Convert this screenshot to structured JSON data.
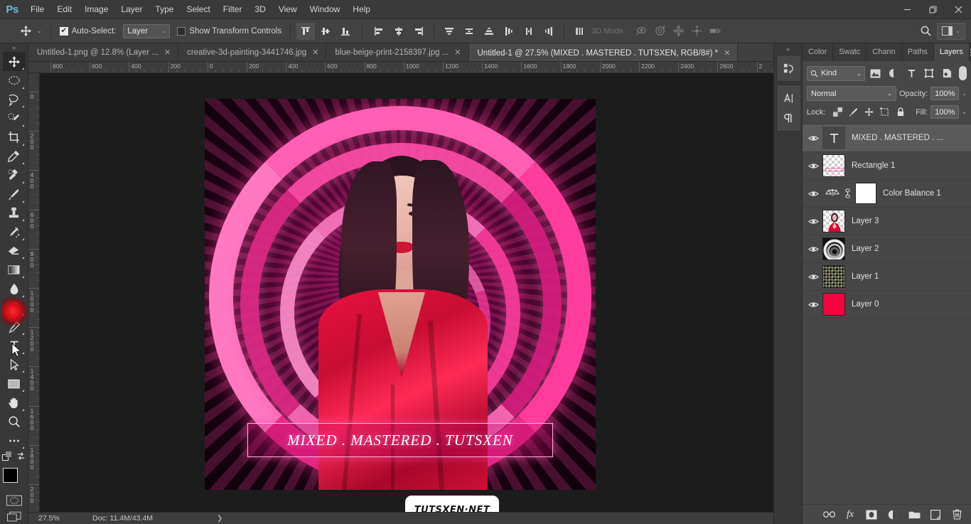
{
  "app": {
    "logo": "Ps",
    "menus": [
      "File",
      "Edit",
      "Image",
      "Layer",
      "Type",
      "Select",
      "Filter",
      "3D",
      "View",
      "Window",
      "Help"
    ],
    "window_controls": {
      "minimize": "—",
      "maximize": "❐",
      "close": "✕"
    }
  },
  "options_bar": {
    "tool_name": "move-tool",
    "auto_select_label": "Auto-Select:",
    "auto_select_checked": true,
    "auto_select_value": "Layer",
    "show_transform_label": "Show Transform Controls",
    "show_transform_checked": false,
    "align_buttons": [
      "align-top-edges",
      "align-vertical-centers",
      "align-bottom-edges",
      "align-left-edges",
      "align-horizontal-centers",
      "align-right-edges",
      "distribute-top-edges",
      "distribute-vertical-centers",
      "distribute-bottom-edges",
      "distribute-left-edges",
      "distribute-horizontal-centers",
      "distribute-right-edges",
      "align-distribute-options"
    ],
    "mode_3d_label": "3D Mode:",
    "mode_3d_icons": [
      "orbit-3d-icon",
      "roll-3d-icon",
      "pan-3d-icon",
      "slide-3d-icon",
      "scale-3d-icon"
    ],
    "search_icon": "search-icon",
    "workspace_icon": "workspace-switcher-icon"
  },
  "tabs": [
    {
      "title": "Untitled-1.png @ 12.8% (Layer ...",
      "active": false,
      "close": "✕"
    },
    {
      "title": "creative-3d-painting-3441746.jpg",
      "active": false,
      "close": "✕"
    },
    {
      "title": "blue-beige-print-2158397.jpg ...",
      "active": false,
      "close": "✕"
    },
    {
      "title": "Untitled-1 @ 27.5% (MIXED .  MASTERED  .  TUTSXEN, RGB/8#) *",
      "active": true,
      "close": "✕"
    }
  ],
  "toolbar": {
    "collapse_icon": "double-chevron-right-icon",
    "tools_top": [
      {
        "name": "move-tool",
        "active": true
      },
      {
        "name": "elliptical-marquee-tool",
        "active": false
      },
      {
        "name": "lasso-tool",
        "active": false
      },
      {
        "name": "quick-selection-tool",
        "active": false
      },
      {
        "name": "crop-tool",
        "active": false
      },
      {
        "name": "eyedropper-tool",
        "active": false
      },
      {
        "name": "spot-healing-brush-tool",
        "active": false
      },
      {
        "name": "brush-tool",
        "active": false
      },
      {
        "name": "clone-stamp-tool",
        "active": false
      },
      {
        "name": "history-brush-tool",
        "active": false
      },
      {
        "name": "eraser-tool",
        "active": false
      },
      {
        "name": "gradient-tool",
        "active": false
      }
    ],
    "tools_bottom": [
      {
        "name": "blur-tool",
        "active": false
      },
      {
        "name": "dodge-tool",
        "active": false
      },
      {
        "name": "pen-tool",
        "active": false
      },
      {
        "name": "horizontal-type-tool",
        "active": true
      },
      {
        "name": "path-selection-tool",
        "active": false
      },
      {
        "name": "rectangle-tool",
        "active": false
      },
      {
        "name": "hand-tool",
        "active": false
      },
      {
        "name": "zoom-tool",
        "active": false
      },
      {
        "name": "edit-toolbar-tool",
        "active": false
      }
    ],
    "colors": {
      "foreground": "#000000",
      "background": "#d81f47",
      "swap_icon": "swap-colors-icon",
      "default_icon": "default-colors-icon"
    },
    "quick_mask_icon": "quick-mask-mode-icon",
    "screen_mode_icon": "screen-mode-icon"
  },
  "rulers": {
    "horizontal_labels": [
      "800",
      "600",
      "400",
      "200",
      "0",
      "200",
      "400",
      "600",
      "800",
      "1000",
      "1200",
      "1400",
      "1600",
      "1800",
      "2000",
      "2200",
      "2400",
      "2600",
      "2"
    ],
    "vertical_labels": [
      "0",
      "200",
      "400",
      "600",
      "800",
      "1000",
      "1200",
      "1400",
      "1600",
      "1800",
      "200"
    ]
  },
  "canvas": {
    "background_color": "#1c1c1c",
    "artwork": {
      "banner_text": "MIXED .  MASTERED  .  TUTSXEN",
      "accent_color": "#ff3d9e",
      "robe_color": "#e8123f"
    },
    "watermark": "TUTSXEN·NET"
  },
  "right_strip": {
    "collapse_icon": "double-chevron-left-icon",
    "buttons": [
      "history-icon",
      "character-panel-icon",
      "paragraph-panel-icon"
    ]
  },
  "layers_panel": {
    "tabs": [
      {
        "label": "Color",
        "active": false
      },
      {
        "label": "Swatc",
        "active": false
      },
      {
        "label": "Chann",
        "active": false
      },
      {
        "label": "Paths",
        "active": false
      },
      {
        "label": "Layers",
        "active": true
      }
    ],
    "menu_icon": "panel-menu-icon",
    "filter": {
      "search_icon": "search-icon",
      "kind_label": "Kind",
      "chevron": "⌄",
      "filter_icons": [
        "filter-pixel-icon",
        "filter-adjustment-icon",
        "filter-type-icon",
        "filter-shape-icon",
        "filter-smart-object-icon"
      ],
      "toggle_name": "filter-enable-toggle"
    },
    "blend_mode": "Normal",
    "opacity_label": "Opacity:",
    "opacity_value": "100%",
    "lock_label": "Lock:",
    "lock_icons": [
      "lock-transparent-pixels-icon",
      "lock-image-pixels-icon",
      "lock-position-icon",
      "lock-artboard-nesting-icon",
      "lock-all-icon"
    ],
    "fill_label": "Fill:",
    "fill_value": "100%",
    "layers": [
      {
        "name": "MIXED .  MASTERED  .  ...",
        "type": "text",
        "selected": true,
        "visible": true
      },
      {
        "name": "Rectangle 1",
        "type": "shape",
        "selected": false,
        "visible": true
      },
      {
        "name": "Color Balance 1",
        "type": "adjustment",
        "selected": false,
        "visible": true
      },
      {
        "name": "Layer 3",
        "type": "image-portrait",
        "selected": false,
        "visible": true
      },
      {
        "name": "Layer 2",
        "type": "image-rings",
        "selected": false,
        "visible": true
      },
      {
        "name": "Layer 1",
        "type": "image-pattern",
        "selected": false,
        "visible": true
      },
      {
        "name": "Layer 0",
        "type": "image-solid",
        "selected": false,
        "visible": true
      }
    ],
    "footer_buttons": [
      "link-layers-icon",
      "add-layer-style-icon",
      "add-layer-mask-icon",
      "new-adjustment-layer-icon",
      "new-group-icon",
      "new-layer-icon",
      "delete-layer-icon"
    ],
    "footer_fx_label": "fx"
  },
  "status_bar": {
    "zoom": "27.5%",
    "doc_info": "Doc: 11.4M/43.4M",
    "expand_arrow": "❯"
  }
}
